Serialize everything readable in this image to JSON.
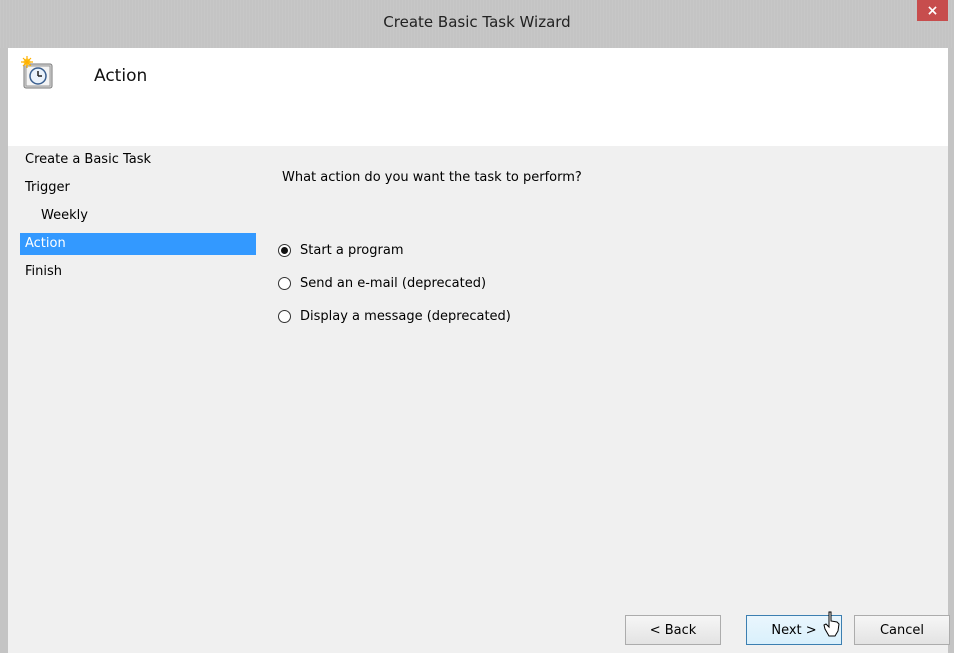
{
  "window": {
    "title": "Create Basic Task Wizard",
    "close_symbol": "×",
    "colors": {
      "close": "#c74d4d",
      "selection": "#3399ff"
    }
  },
  "header": {
    "icon": "task-scheduler-icon",
    "title": "Action"
  },
  "steps": [
    {
      "label": "Create a Basic Task",
      "indent": false,
      "active": false
    },
    {
      "label": "Trigger",
      "indent": false,
      "active": false
    },
    {
      "label": "Weekly",
      "indent": true,
      "active": false
    },
    {
      "label": "Action",
      "indent": false,
      "active": true
    },
    {
      "label": "Finish",
      "indent": false,
      "active": false
    }
  ],
  "main": {
    "question": "What action do you want the task to perform?",
    "options": [
      {
        "label": "Start a program",
        "checked": true
      },
      {
        "label": "Send an e-mail (deprecated)",
        "checked": false
      },
      {
        "label": "Display a message (deprecated)",
        "checked": false
      }
    ]
  },
  "buttons": {
    "back": "< Back",
    "next": "Next >",
    "cancel": "Cancel"
  }
}
